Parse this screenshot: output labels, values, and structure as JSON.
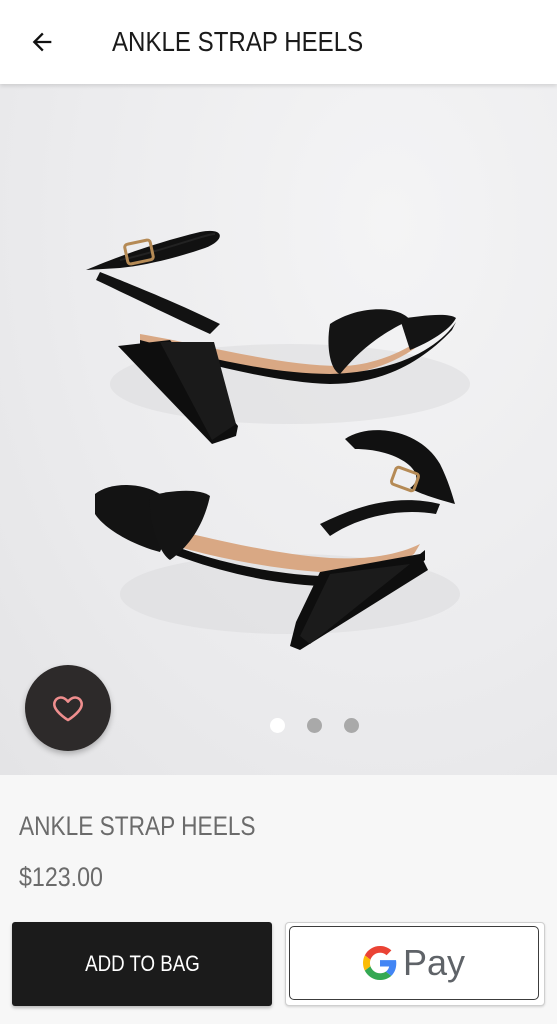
{
  "header": {
    "title": "ANKLE STRAP HEELS",
    "back_icon": "arrow-left-icon"
  },
  "gallery": {
    "image": "black ankle strap heeled sandals",
    "favorite_icon": "heart-outline-icon",
    "favorite_icon_color": "#ef8e8e",
    "page_count": 3,
    "active_page": 1
  },
  "product": {
    "name": "ANKLE STRAP HEELS",
    "price": "$123.00"
  },
  "actions": {
    "add_to_bag_label": "ADD TO BAG",
    "gpay_label": "Pay",
    "gpay_icon": "google-g-icon"
  },
  "colors": {
    "primary_button": "#1b1b1b",
    "fav_button": "#2d2a2a",
    "text_muted": "#6b6b6b"
  }
}
